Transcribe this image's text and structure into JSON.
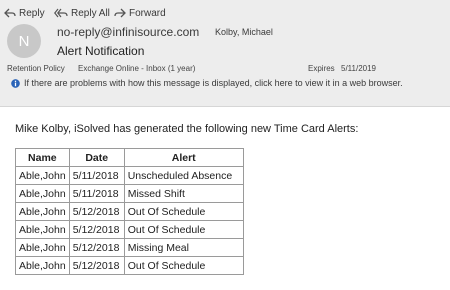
{
  "toolbar": {
    "reply_label": "Reply",
    "reply_all_label": "Reply All",
    "forward_label": "Forward"
  },
  "message": {
    "avatar_initial": "N",
    "from": "no-reply@infinisource.com",
    "to": "Kolby, Michael",
    "subject": "Alert Notification",
    "retention_label": "Retention Policy",
    "retention_value": "Exchange Online - Inbox (1 year)",
    "expires_label": "Expires",
    "expires_value": "5/11/2019",
    "info_text": "If there are problems with how this message is displayed, click here to view it in a web browser."
  },
  "body": {
    "intro": "Mike Kolby, iSolved has generated the following new Time Card Alerts:",
    "table": {
      "headers": [
        "Name",
        "Date",
        "Alert"
      ],
      "rows": [
        [
          "Able,John",
          "5/11/2018",
          "Unscheduled Absence"
        ],
        [
          "Able,John",
          "5/11/2018",
          "Missed Shift"
        ],
        [
          "Able,John",
          "5/12/2018",
          "Out Of Schedule"
        ],
        [
          "Able,John",
          "5/12/2018",
          "Out Of Schedule"
        ],
        [
          "Able,John",
          "5/12/2018",
          "Missing Meal"
        ],
        [
          "Able,John",
          "5/12/2018",
          "Out Of Schedule"
        ]
      ]
    }
  },
  "colors": {
    "header_bg": "#ededed",
    "avatar_bg": "#c8c8c8",
    "info_icon": "#2b64b8",
    "text": "#262626"
  },
  "icons": {
    "reply": "reply-icon",
    "reply_all": "reply-all-icon",
    "forward": "forward-icon",
    "info": "info-icon"
  }
}
